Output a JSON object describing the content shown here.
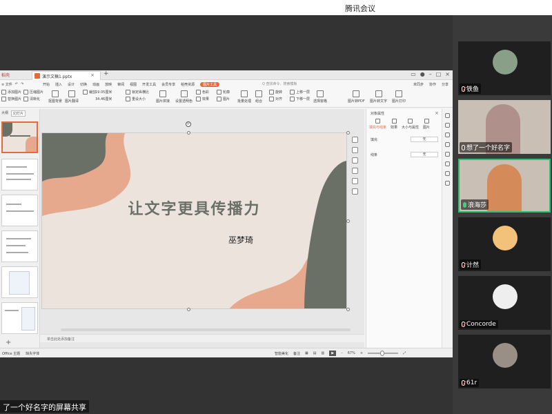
{
  "meeting": {
    "title": "腾讯会议",
    "share_caption": "了一个好名字的屏幕共享"
  },
  "wps": {
    "app_tab": "稻壳",
    "doc_tab": "演示文稿1.pptx",
    "menu_left": [
      "≡ 文件",
      "↶",
      "↷"
    ],
    "menu_items": [
      "开始",
      "插入",
      "设计",
      "切换",
      "动画",
      "放映",
      "审阅",
      "视图",
      "开发工具",
      "会员专享",
      "稻壳资源",
      "图片工具"
    ],
    "active_menu": "图片工具",
    "search_placeholder": "Q 查找命令、搜索模板",
    "menu_right": [
      "未同步",
      "协作",
      "分享"
    ],
    "ribbon": {
      "g1": [
        "添加图片",
        "替换图片"
      ],
      "g2": [
        "压缩图片",
        "清晰化"
      ],
      "big1": "抠图背景",
      "big2": "图片翻译",
      "size_h": "19.05厘米",
      "size_w": "34.46厘米",
      "lock_ratio": "锁定纵横比",
      "reset_size": "重设大小",
      "crop": "裁剪",
      "big3": "图片拼接",
      "big4": "设置透明色",
      "g3": [
        "色彩",
        "效果"
      ],
      "g4": [
        "轮廓",
        "图片"
      ],
      "big5": "批量处理",
      "big6": "组合",
      "g5": [
        "旋转",
        "对齐"
      ],
      "g6": [
        "上移一层",
        "下移一层"
      ],
      "big7": "选择窗格",
      "big8": "图片转PDF",
      "big9": "图片转文字",
      "big10": "图片打印"
    },
    "thumb_tabs": [
      "大纲",
      "幻灯片"
    ],
    "slide": {
      "title": "让文字更具传播力",
      "author": "巫梦琦"
    },
    "notes_placeholder": "单击此处添加备注",
    "props": {
      "title": "对象属性",
      "tabs": [
        "填充与线条",
        "效果",
        "大小与属性",
        "图片"
      ],
      "rows": [
        {
          "label": "填充",
          "value": "无"
        },
        {
          "label": "线条",
          "value": "无"
        }
      ]
    },
    "status": {
      "left": [
        "Office 主题",
        "缺失字体"
      ],
      "smart": "智能美化",
      "notes": "备注",
      "zoom": "67%"
    }
  },
  "participants": [
    {
      "name": "铁鱼",
      "mic": "muted",
      "type": "avatar"
    },
    {
      "name": "想了一个好名字",
      "mic": "on",
      "type": "video"
    },
    {
      "name": "浪海莎",
      "mic": "active",
      "type": "video"
    },
    {
      "name": "计然",
      "mic": "muted",
      "type": "avatar"
    },
    {
      "name": "Concorde",
      "mic": "muted",
      "type": "avatar"
    },
    {
      "name": "61r",
      "mic": "muted",
      "type": "avatar"
    }
  ],
  "colors": {
    "slide_bg": "#ece3dc",
    "slide_sage": "#6b7066",
    "slide_peach": "#e6a98e",
    "wps_accent": "#e8683d",
    "speaking_border": "#2ec06f"
  }
}
